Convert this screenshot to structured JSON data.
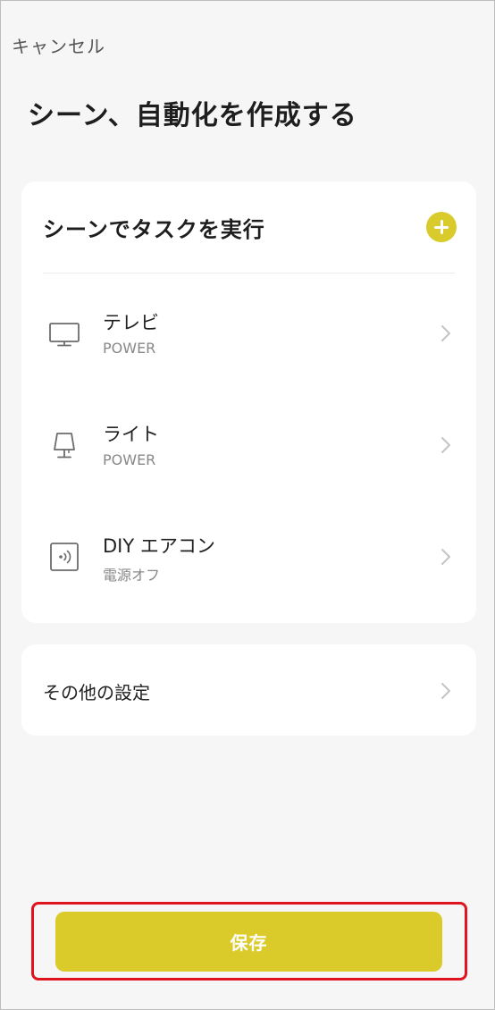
{
  "header": {
    "cancel_label": "キャンセル",
    "title": "シーン、自動化を作成する"
  },
  "tasks": {
    "title": "シーンでタスクを実行",
    "add_icon": "plus-circle-icon",
    "devices": [
      {
        "name": "テレビ",
        "status": "POWER",
        "icon": "tv-icon"
      },
      {
        "name": "ライト",
        "status": "POWER",
        "icon": "lamp-icon"
      },
      {
        "name": "DIY エアコン",
        "status": "電源オフ",
        "icon": "remote-icon"
      }
    ]
  },
  "settings": {
    "label": "その他の設定"
  },
  "footer": {
    "save_label": "保存"
  },
  "colors": {
    "accent": "#dbcb2a",
    "highlight": "#e0141e",
    "background": "#f6f6f6"
  }
}
